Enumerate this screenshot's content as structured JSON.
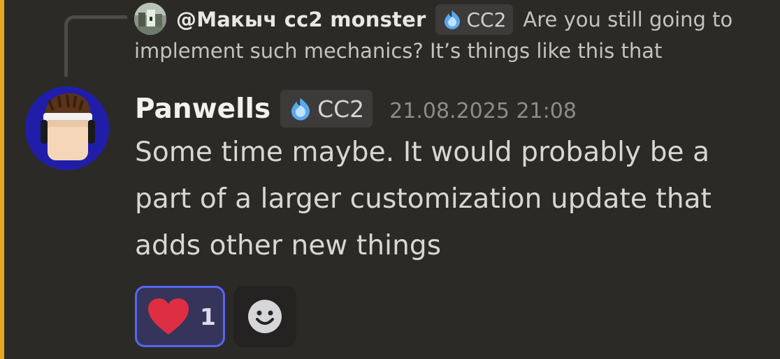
{
  "reply": {
    "author": "@Макыч cc2 monster",
    "tag": "CC2",
    "text_line1": "Are you still going to",
    "text_line2": "implement such mechanics? It’s things like this that"
  },
  "message": {
    "author": "Panwells",
    "tag": "CC2",
    "timestamp": "21.08.2025 21:08",
    "lines": [
      "Some time maybe. It would probably be a",
      "part of a larger customization update that",
      "adds other new things"
    ]
  },
  "reactions": [
    {
      "emoji": "heart",
      "count": "1",
      "active": true
    }
  ],
  "colors": {
    "background": "#2c2a27",
    "accent_bar": "#e6a521",
    "reaction_active_border": "#5865f2",
    "reaction_active_bg": "#35345a",
    "heart": "#dd2e44",
    "tag_icon": "#5aa8f0"
  },
  "icons": {
    "tag": "flame-gem-icon",
    "add_reaction": "smiley-face-icon"
  }
}
